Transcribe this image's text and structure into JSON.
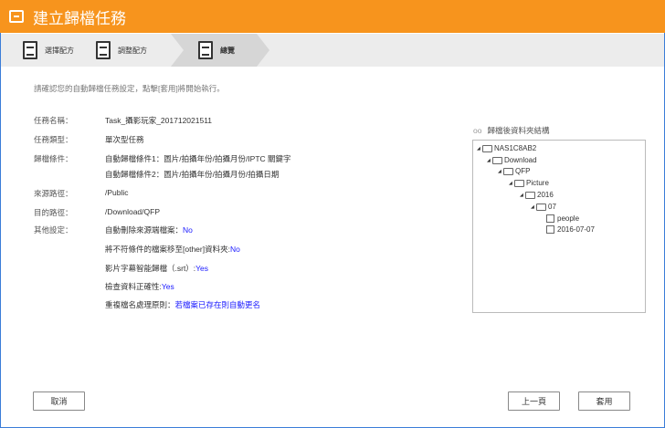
{
  "title": "建立歸檔任務",
  "steps": [
    "選擇配方",
    "調整配方",
    "總覽"
  ],
  "message": "請確認您的自動歸檔任務設定，點擊[套用]將開始執行。",
  "fields": {
    "name_label": "任務名稱：",
    "name": "Task_攝影玩家_201712021511",
    "type_label": "任務類型：",
    "type": "單次型任務",
    "cond_label": "歸檔條件：",
    "cond1": "自動歸檔條件1：圖片/拍攝年份/拍攝月份/IPTC 關鍵字",
    "cond2": "自動歸檔條件2：圖片/拍攝年份/拍攝月份/拍攝日期",
    "src_label": "來源路徑：",
    "src": "/Public",
    "dst_label": "目的路徑：",
    "dst": "/Download/QFP",
    "other_label": "其他設定：",
    "o1": "自動刪除來源端檔案：",
    "o1v": "No",
    "o2": "將不符條件的檔案移至[other]資料夾:",
    "o2v": "No",
    "o3": "影片字幕智能歸檔（.srt）:",
    "o3v": "Yes",
    "o4": "檢查資料正確性:",
    "o4v": "Yes",
    "o5": "重複檔名處理原則：",
    "o5v": "若檔案已存在則自動更名"
  },
  "tree": {
    "title": "歸檔後資料夾結構",
    "nodes": [
      "NAS1C8AB2",
      "Download",
      "QFP",
      "Picture",
      "2016",
      "07"
    ],
    "files": [
      "people",
      "2016-07-07"
    ]
  },
  "buttons": {
    "cancel": "取消",
    "prev": "上一頁",
    "apply": "套用"
  }
}
